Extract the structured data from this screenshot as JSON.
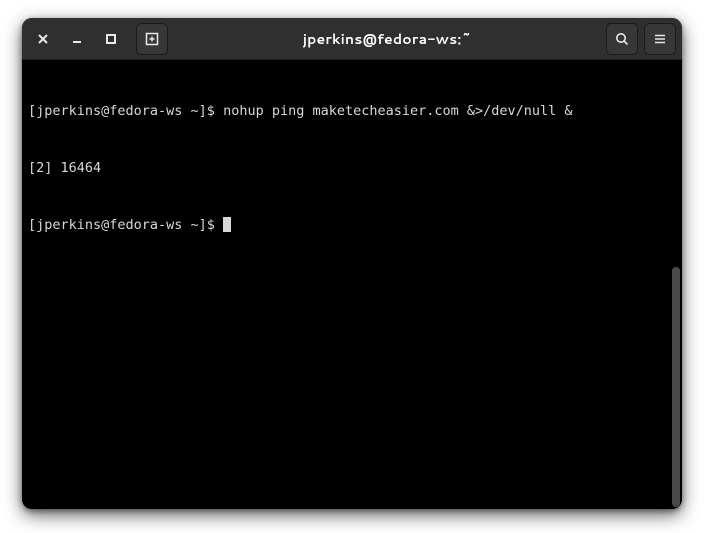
{
  "window": {
    "title": "jperkins@fedora-ws:~"
  },
  "terminal": {
    "lines": [
      "[jperkins@fedora-ws ~]$ nohup ping maketecheasier.com &>/dev/null &",
      "[2] 16464",
      "[jperkins@fedora-ws ~]$ "
    ]
  }
}
